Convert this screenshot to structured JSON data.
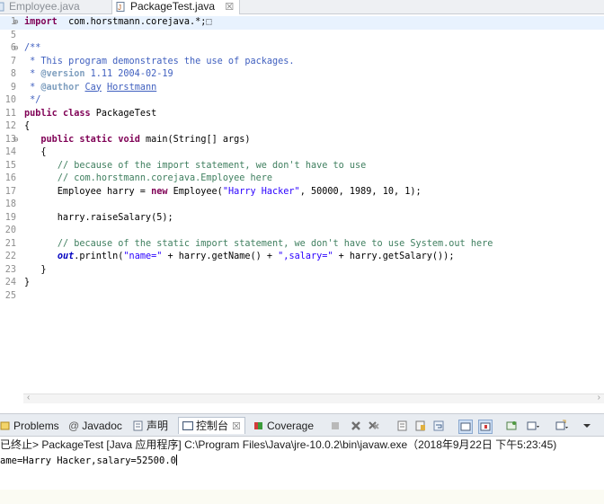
{
  "editor_tabs": [
    {
      "label": "Employee.java",
      "active": false
    },
    {
      "label": "PackageTest.java",
      "active": true,
      "close": "☒"
    }
  ],
  "code_lines": [
    {
      "n": "1",
      "fold": "⊕",
      "parts": [
        [
          "kw",
          "import"
        ],
        [
          "",
          "  com.horstmann.corejava.*;"
        ],
        [
          "",
          "⬚"
        ]
      ]
    },
    {
      "n": "5",
      "fold": "",
      "parts": []
    },
    {
      "n": "6",
      "fold": "⊖",
      "parts": [
        [
          "jd",
          "/**"
        ]
      ]
    },
    {
      "n": "7",
      "fold": "",
      "parts": [
        [
          "jd",
          " * This program demonstrates the use of packages."
        ]
      ]
    },
    {
      "n": "8",
      "fold": "",
      "parts": [
        [
          "jd",
          " * "
        ],
        [
          "jt",
          "@version"
        ],
        [
          "jd",
          " 1.11 2004-02-19"
        ]
      ]
    },
    {
      "n": "9",
      "fold": "",
      "parts": [
        [
          "jd",
          " * "
        ],
        [
          "jt",
          "@author"
        ],
        [
          "jd",
          " "
        ],
        [
          "jdul",
          "Cay"
        ],
        [
          "jd",
          " "
        ],
        [
          "jdul",
          "Horstmann"
        ]
      ]
    },
    {
      "n": "10",
      "fold": "",
      "parts": [
        [
          "jd",
          " */"
        ]
      ]
    },
    {
      "n": "11",
      "fold": "",
      "parts": [
        [
          "kw",
          "public"
        ],
        [
          "",
          " "
        ],
        [
          "kw",
          "class"
        ],
        [
          "",
          " PackageTest"
        ]
      ]
    },
    {
      "n": "12",
      "fold": "",
      "parts": [
        [
          "",
          "{"
        ]
      ]
    },
    {
      "n": "13",
      "fold": "⊖",
      "parts": [
        [
          "",
          "   "
        ],
        [
          "kw",
          "public"
        ],
        [
          "",
          " "
        ],
        [
          "kw",
          "static"
        ],
        [
          "",
          " "
        ],
        [
          "kw",
          "void"
        ],
        [
          "",
          " main(String[] args)"
        ]
      ]
    },
    {
      "n": "14",
      "fold": "",
      "parts": [
        [
          "",
          "   {"
        ]
      ]
    },
    {
      "n": "15",
      "fold": "",
      "parts": [
        [
          "",
          "      "
        ],
        [
          "cm",
          "// because of the import statement, we don't have to use"
        ]
      ]
    },
    {
      "n": "16",
      "fold": "",
      "parts": [
        [
          "",
          "      "
        ],
        [
          "cm",
          "// com.horstmann.corejava.Employee here"
        ]
      ]
    },
    {
      "n": "17",
      "fold": "",
      "parts": [
        [
          "",
          "      Employee harry = "
        ],
        [
          "kw",
          "new"
        ],
        [
          "",
          " Employee("
        ],
        [
          "str",
          "\"Harry Hacker\""
        ],
        [
          "",
          ", 50000, 1989, 10, 1);"
        ]
      ]
    },
    {
      "n": "18",
      "fold": "",
      "parts": []
    },
    {
      "n": "19",
      "fold": "",
      "parts": [
        [
          "",
          "      harry.raiseSalary(5);"
        ]
      ]
    },
    {
      "n": "20",
      "fold": "",
      "parts": []
    },
    {
      "n": "21",
      "fold": "",
      "parts": [
        [
          "",
          "      "
        ],
        [
          "cm",
          "// because of the static import statement, we don't have to use System.out here"
        ]
      ]
    },
    {
      "n": "22",
      "fold": "",
      "parts": [
        [
          "",
          "      "
        ],
        [
          "it",
          "out"
        ],
        [
          "",
          ".println("
        ],
        [
          "str",
          "\"name=\""
        ],
        [
          "",
          " + harry.getName() + "
        ],
        [
          "str",
          "\",salary=\""
        ],
        [
          "",
          " + harry.getSalary());"
        ]
      ]
    },
    {
      "n": "23",
      "fold": "",
      "parts": [
        [
          "",
          "   }"
        ]
      ]
    },
    {
      "n": "24",
      "fold": "",
      "parts": [
        [
          "",
          "}"
        ]
      ]
    },
    {
      "n": "25",
      "fold": "",
      "parts": []
    }
  ],
  "console_tabs": {
    "problems": "Problems",
    "javadoc": "Javadoc",
    "declaration": "声明",
    "console": "控制台",
    "console_close": "☒",
    "coverage": "Coverage"
  },
  "console_header": "已终止> PackageTest [Java 应用程序] C:\\Program Files\\Java\\jre-10.0.2\\bin\\javaw.exe（2018年9月22日 下午5:23:45)",
  "console_output": "ame=Harry Hacker,salary=52500.0",
  "colors": {
    "keyword": "#7f0055",
    "comment": "#3f7f5f",
    "javadoc": "#3f5fbf",
    "string": "#2a00ff",
    "field": "#0000c0"
  }
}
